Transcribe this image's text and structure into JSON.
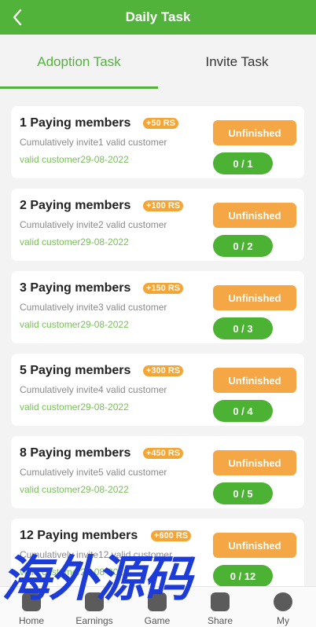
{
  "header": {
    "title": "Daily Task"
  },
  "tabs": [
    {
      "label": "Adoption Task",
      "active": true
    },
    {
      "label": "Invite Task",
      "active": false
    }
  ],
  "tasks": [
    {
      "name": "1 Paying members",
      "reward": "+50 RS",
      "desc": "Cumulatively invite1 valid customer",
      "date": "valid customer29-08-2022",
      "status": "Unfinished",
      "progress": "0 / 1"
    },
    {
      "name": "2 Paying members",
      "reward": "+100 RS",
      "desc": "Cumulatively invite2 valid customer",
      "date": "valid customer29-08-2022",
      "status": "Unfinished",
      "progress": "0 / 2"
    },
    {
      "name": "3 Paying members",
      "reward": "+150 RS",
      "desc": "Cumulatively invite3 valid customer",
      "date": "valid customer29-08-2022",
      "status": "Unfinished",
      "progress": "0 / 3"
    },
    {
      "name": "5 Paying members",
      "reward": "+300 RS",
      "desc": "Cumulatively invite4 valid customer",
      "date": "valid customer29-08-2022",
      "status": "Unfinished",
      "progress": "0 / 4"
    },
    {
      "name": "8 Paying members",
      "reward": "+450 RS",
      "desc": "Cumulatively invite5 valid customer",
      "date": "valid customer29-08-2022",
      "status": "Unfinished",
      "progress": "0 / 5"
    },
    {
      "name": "12 Paying members",
      "reward": "+600 RS",
      "desc": "Cumulatively invite12 valid customer",
      "date": "valid customer29-08-2022",
      "status": "Unfinished",
      "progress": "0 / 12"
    }
  ],
  "tabbar": [
    {
      "label": "Home",
      "icon": "home-icon"
    },
    {
      "label": "Earnings",
      "icon": "earnings-icon"
    },
    {
      "label": "Game",
      "icon": "game-icon"
    },
    {
      "label": "Share",
      "icon": "share-icon"
    },
    {
      "label": "My",
      "icon": "my-icon"
    }
  ],
  "watermark": {
    "text": "海外源码"
  },
  "colors": {
    "primary": "#52b33b",
    "accent": "#f3a536",
    "progress": "#4cb234"
  }
}
